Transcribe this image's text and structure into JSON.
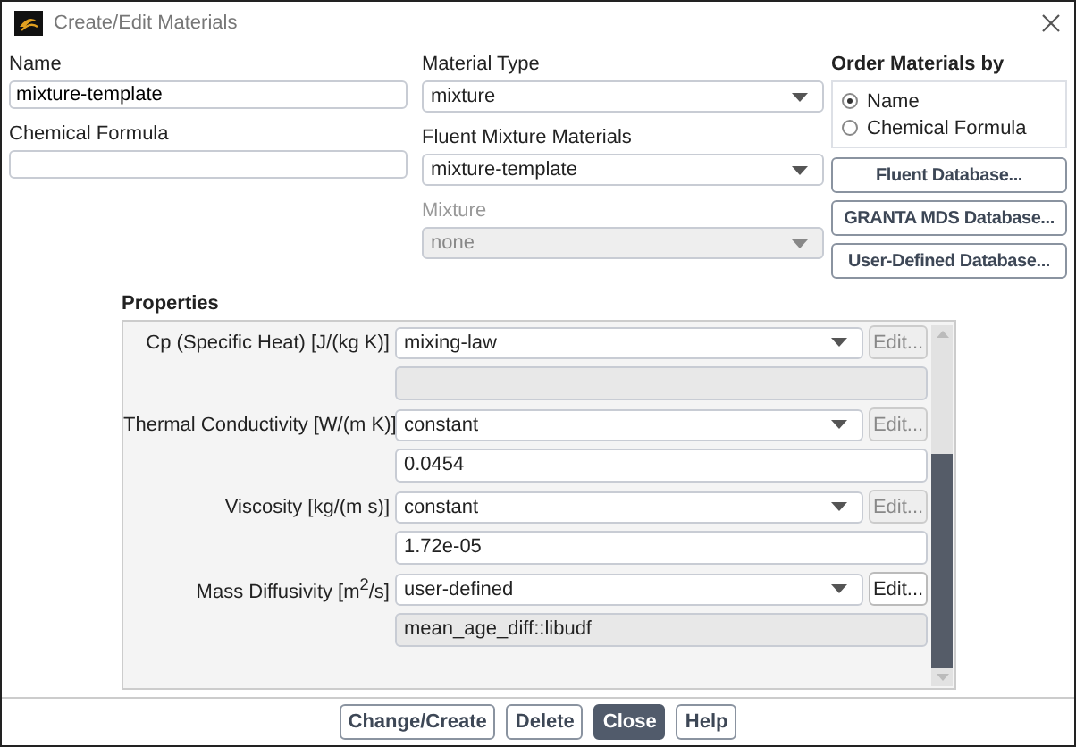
{
  "window": {
    "title": "Create/Edit Materials"
  },
  "name_field": {
    "label": "Name",
    "value": "mixture-template"
  },
  "formula_field": {
    "label": "Chemical Formula"
  },
  "material_type": {
    "label": "Material Type",
    "value": "mixture",
    "disabled": false
  },
  "fluent_materials": {
    "label": "Fluent Mixture Materials",
    "value": "mixture-template",
    "disabled": false
  },
  "mixture": {
    "label": "Mixture",
    "value": "none",
    "disabled": true
  },
  "order_by": {
    "title": "Order Materials by",
    "options": [
      {
        "label": "Name",
        "selected": true
      },
      {
        "label": "Chemical Formula",
        "selected": false
      }
    ]
  },
  "database_buttons": [
    "Fluent Database...",
    "GRANTA MDS Database...",
    "User-Defined Database..."
  ],
  "properties": {
    "title": "Properties",
    "rows": [
      {
        "label": "Cp (Specific Heat) [J/(kg K)]",
        "method": "mixing-law",
        "edit": "Edit...",
        "edit_disabled": true,
        "value_disabled": true
      },
      {
        "label": "Thermal Conductivity [W/(m K)]",
        "method": "constant",
        "edit": "Edit...",
        "edit_disabled": true,
        "value": "0.0454",
        "value_disabled": false
      },
      {
        "label": "Viscosity [kg/(m s)]",
        "method": "constant",
        "edit": "Edit...",
        "edit_disabled": true,
        "value": "1.72e-05",
        "value_disabled": false
      },
      {
        "label": "Mass Diffusivity [m$^{2}$/s]",
        "method": "user-defined",
        "edit": "Edit...",
        "edit_disabled": false,
        "value": "mean_age_diff::libudf",
        "value_disabled": true
      }
    ]
  },
  "buttons": [
    {
      "label": "Change/Create",
      "primary": false
    },
    {
      "label": "Delete",
      "primary": false
    },
    {
      "label": "Close",
      "primary": true
    },
    {
      "label": "Help",
      "primary": false
    }
  ]
}
